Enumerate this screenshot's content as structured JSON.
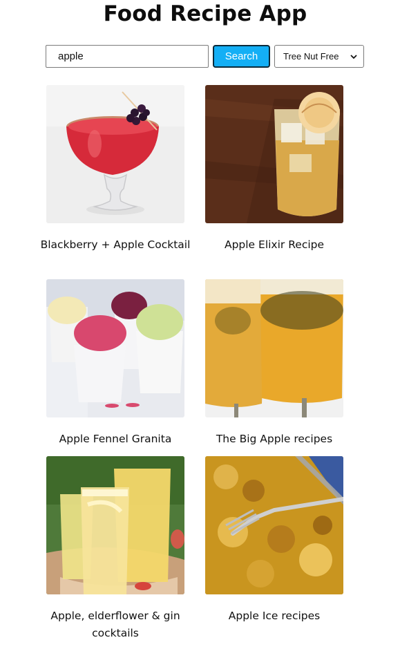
{
  "app": {
    "title": "Food Recipe App"
  },
  "search": {
    "value": "apple",
    "button_label": "Search"
  },
  "filter": {
    "selected": "Tree Nut Free"
  },
  "recipes": [
    {
      "title": "Blackberry + Apple Cocktail",
      "image": "red cocktail with blackberry garnish"
    },
    {
      "title": "Apple Elixir Recipe",
      "image": "amber drink with dried apple slice"
    },
    {
      "title": "Apple Fennel Granita",
      "image": "colorful granita cups"
    },
    {
      "title": "The Big Apple recipes",
      "image": "two golden glasses"
    },
    {
      "title": "Apple, elderflower & gin cocktails",
      "image": "glasses of pale yellow drinks"
    },
    {
      "title": "Apple Ice recipes",
      "image": "golden granita with fork"
    }
  ],
  "colors": {
    "accent": "#14aff5"
  }
}
